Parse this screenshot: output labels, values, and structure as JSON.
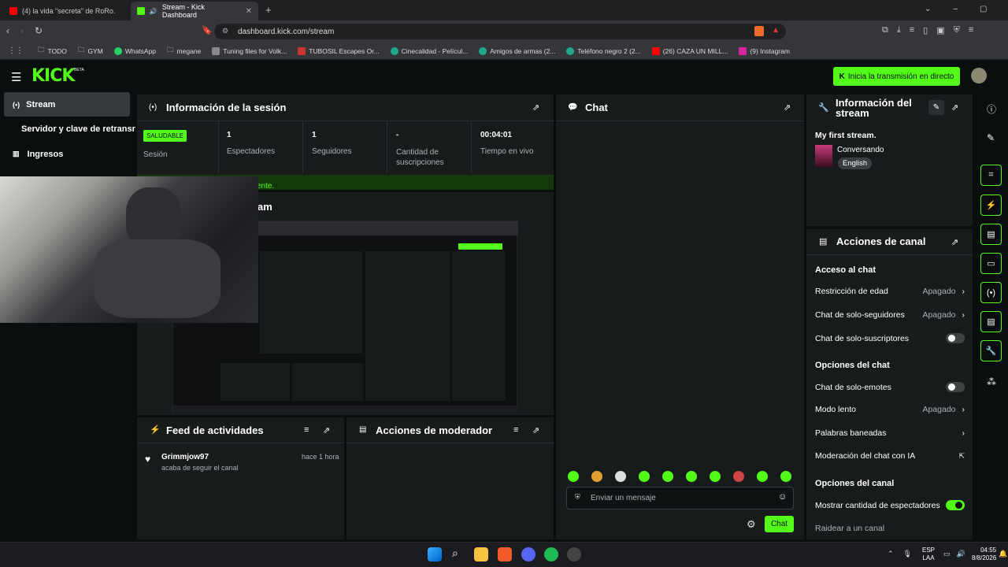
{
  "browser": {
    "tabs": [
      {
        "title": "(4) la vida \"secreta\" de RoRo. - YouTu"
      },
      {
        "title": "Stream - Kick Dashboard"
      }
    ],
    "new_tab": "+",
    "url": "dashboard.kick.com/stream",
    "bookmarks": [
      "TODO",
      "GYM",
      "WhatsApp",
      "megane",
      "Tuning files for Volk...",
      "TUBOSIL Escapes Or...",
      "Cinecalidad - Películ...",
      "Amigos de armas (2...",
      "Teléfono negro 2 (2...",
      "(26) CAZA UN MILL...",
      "(9) Instagram"
    ]
  },
  "header": {
    "logo": "KICK",
    "logo_badge": "BETA",
    "go_live_label": "Inicia la transmisión en directo"
  },
  "sidebar": {
    "items": [
      {
        "label": "Stream"
      },
      {
        "label": "Servidor y clave de retransn"
      },
      {
        "label": "Ingresos"
      }
    ]
  },
  "session": {
    "title": "Información de la sesión",
    "status_badge": "SALUDABLE",
    "status_label": "Sesión",
    "stats": [
      {
        "value": "1",
        "label": "Espectadores"
      },
      {
        "value": "1",
        "label": "Seguidores"
      },
      {
        "value": "-",
        "label": "Cantidad de suscripciones"
      },
      {
        "value": "00:04:01",
        "label": "Tiempo en vivo"
      }
    ],
    "partial_notice": "ente.",
    "preview_title_partial": "am"
  },
  "chat": {
    "title": "Chat",
    "input_placeholder": "Enviar un mensaje",
    "send_label": "Chat"
  },
  "stream_info": {
    "title": "Información del stream",
    "stream_title": "My first stream.",
    "category": "Conversando",
    "language": "English"
  },
  "activity": {
    "title": "Feed de actividades",
    "items": [
      {
        "user": "Grimmjow97",
        "time": "hace 1 hora",
        "text": "acaba de seguir el canal"
      }
    ]
  },
  "moderator": {
    "title": "Acciones de moderador"
  },
  "channel_actions": {
    "title": "Acciones de canal",
    "chat_access_title": "Acceso al chat",
    "age_restriction": {
      "label": "Restricción de edad",
      "value": "Apagado"
    },
    "followers_only": {
      "label": "Chat de solo-seguidores",
      "value": "Apagado"
    },
    "subscribers_only": {
      "label": "Chat de solo-suscriptores"
    },
    "chat_options_title": "Opciones del chat",
    "emotes_only": {
      "label": "Chat de solo-emotes"
    },
    "slow_mode": {
      "label": "Modo lento",
      "value": "Apagado"
    },
    "banned_words": {
      "label": "Palabras baneadas"
    },
    "ai_moderation": {
      "label": "Moderación del chat con IA"
    },
    "channel_options_title": "Opciones del canal",
    "show_viewer_count": {
      "label": "Mostrar cantidad de espectadores",
      "on": true
    },
    "raid": {
      "label": "Raidear a un canal"
    }
  },
  "taskbar": {
    "lang": "ESP",
    "lang2": "LAA",
    "time": "04:55",
    "date": "8/8/2026"
  },
  "colors": {
    "accent": "#53fc18",
    "panel": "#181b1c",
    "background": "#0b0e0f"
  }
}
